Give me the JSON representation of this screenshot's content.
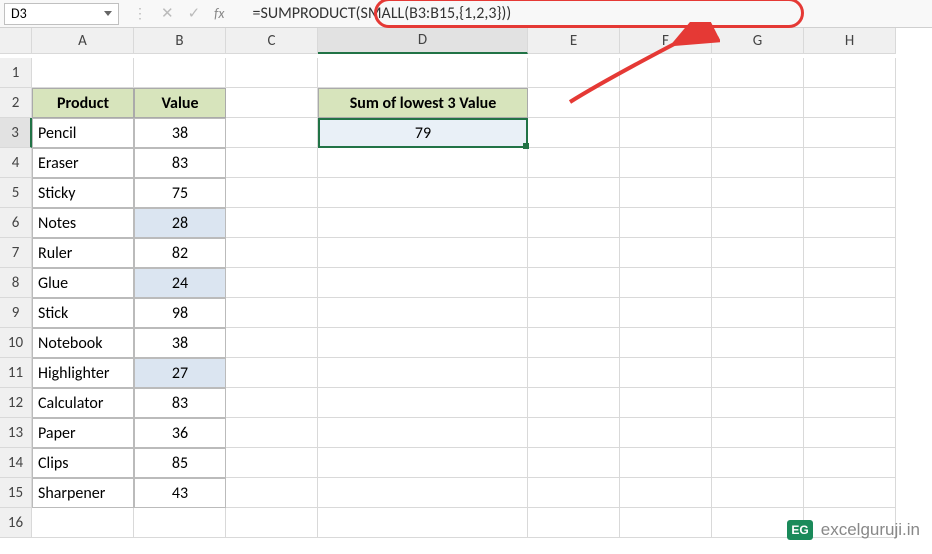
{
  "nameBox": "D3",
  "formula": "=SUMPRODUCT(SMALL(B3:B15,{1,2,3}))",
  "columns": [
    "A",
    "B",
    "C",
    "D",
    "E",
    "F",
    "G",
    "H"
  ],
  "rowNumbers": [
    "1",
    "2",
    "3",
    "4",
    "5",
    "6",
    "7",
    "8",
    "9",
    "10",
    "11",
    "12",
    "13",
    "14",
    "15",
    "16"
  ],
  "headers": {
    "product": "Product",
    "value": "Value",
    "result": "Sum of lowest 3 Value"
  },
  "table": [
    {
      "product": "Pencil",
      "value": "38",
      "hl": false
    },
    {
      "product": "Eraser",
      "value": "83",
      "hl": false
    },
    {
      "product": "Sticky",
      "value": "75",
      "hl": false
    },
    {
      "product": "Notes",
      "value": "28",
      "hl": true
    },
    {
      "product": "Ruler",
      "value": "82",
      "hl": false
    },
    {
      "product": "Glue",
      "value": "24",
      "hl": true
    },
    {
      "product": "Stick",
      "value": "98",
      "hl": false
    },
    {
      "product": "Notebook",
      "value": "38",
      "hl": false
    },
    {
      "product": "Highlighter",
      "value": "27",
      "hl": true
    },
    {
      "product": "Calculator",
      "value": "83",
      "hl": false
    },
    {
      "product": "Paper",
      "value": "36",
      "hl": false
    },
    {
      "product": "Clips",
      "value": "85",
      "hl": false
    },
    {
      "product": "Sharpener",
      "value": "43",
      "hl": false
    }
  ],
  "result": "79",
  "watermark": {
    "badge": "EG",
    "text": "excelguruji.in"
  },
  "fx": "fx",
  "chart_data": {
    "type": "table",
    "title": "Sum of lowest 3 Value",
    "columns": [
      "Product",
      "Value"
    ],
    "rows": [
      [
        "Pencil",
        38
      ],
      [
        "Eraser",
        83
      ],
      [
        "Sticky",
        75
      ],
      [
        "Notes",
        28
      ],
      [
        "Ruler",
        82
      ],
      [
        "Glue",
        24
      ],
      [
        "Stick",
        98
      ],
      [
        "Notebook",
        38
      ],
      [
        "Highlighter",
        27
      ],
      [
        "Calculator",
        83
      ],
      [
        "Paper",
        36
      ],
      [
        "Clips",
        85
      ],
      [
        "Sharpener",
        43
      ]
    ],
    "computed": {
      "label": "Sum of lowest 3 Value",
      "value": 79,
      "formula": "=SUMPRODUCT(SMALL(B3:B15,{1,2,3}))"
    }
  }
}
